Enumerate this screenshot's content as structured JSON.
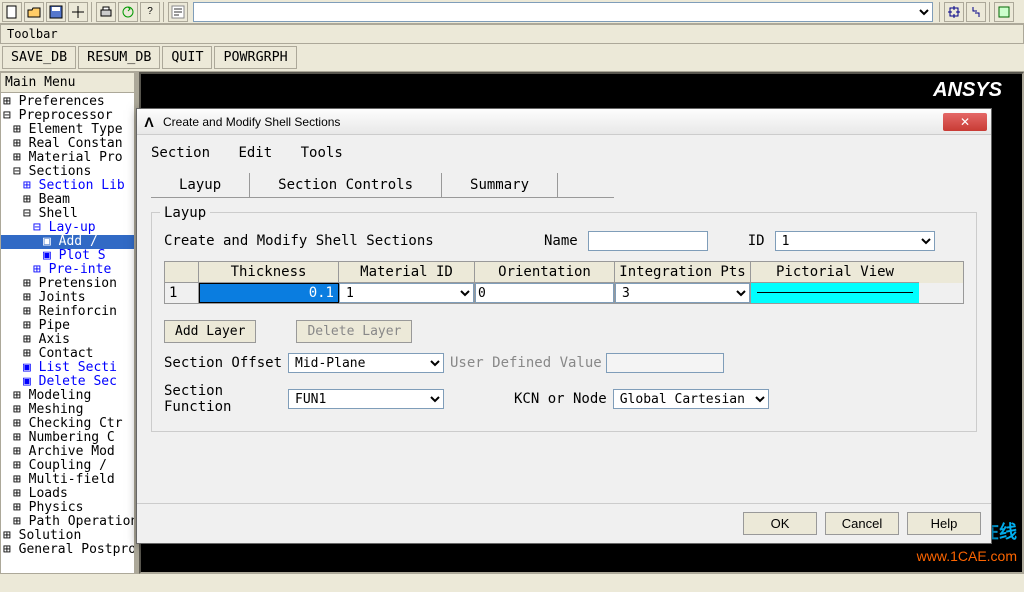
{
  "toolbar": {
    "label": "Toolbar",
    "buttons": [
      "SAVE_DB",
      "RESUM_DB",
      "QUIT",
      "POWRGRPH"
    ]
  },
  "tree": {
    "header": "Main Menu",
    "items": [
      {
        "t": "⊞ Preferences",
        "ind": 0,
        "cls": ""
      },
      {
        "t": "⊟ Preprocessor",
        "ind": 0,
        "cls": ""
      },
      {
        "t": "⊞ Element Type",
        "ind": 1,
        "cls": ""
      },
      {
        "t": "⊞ Real Constan",
        "ind": 1,
        "cls": ""
      },
      {
        "t": "⊞ Material Pro",
        "ind": 1,
        "cls": ""
      },
      {
        "t": "⊟ Sections",
        "ind": 1,
        "cls": ""
      },
      {
        "t": "⊞ Section Lib",
        "ind": 2,
        "cls": "blue"
      },
      {
        "t": "⊞ Beam",
        "ind": 2,
        "cls": ""
      },
      {
        "t": "⊟ Shell",
        "ind": 2,
        "cls": ""
      },
      {
        "t": "⊟ Lay-up",
        "ind": 3,
        "cls": "blue"
      },
      {
        "t": "▣ Add /",
        "ind": 4,
        "cls": "selected"
      },
      {
        "t": "▣ Plot S",
        "ind": 4,
        "cls": "blue"
      },
      {
        "t": "⊞ Pre-inte",
        "ind": 3,
        "cls": "blue"
      },
      {
        "t": "⊞ Pretension",
        "ind": 2,
        "cls": ""
      },
      {
        "t": "⊞ Joints",
        "ind": 2,
        "cls": ""
      },
      {
        "t": "⊞ Reinforcin",
        "ind": 2,
        "cls": ""
      },
      {
        "t": "⊞ Pipe",
        "ind": 2,
        "cls": ""
      },
      {
        "t": "⊞ Axis",
        "ind": 2,
        "cls": ""
      },
      {
        "t": "⊞ Contact",
        "ind": 2,
        "cls": ""
      },
      {
        "t": "▣ List Secti",
        "ind": 2,
        "cls": "blue"
      },
      {
        "t": "▣ Delete Sec",
        "ind": 2,
        "cls": "blue"
      },
      {
        "t": "⊞ Modeling",
        "ind": 1,
        "cls": ""
      },
      {
        "t": "⊞ Meshing",
        "ind": 1,
        "cls": ""
      },
      {
        "t": "⊞ Checking Ctr",
        "ind": 1,
        "cls": ""
      },
      {
        "t": "⊞ Numbering C",
        "ind": 1,
        "cls": ""
      },
      {
        "t": "⊞ Archive Mod",
        "ind": 1,
        "cls": ""
      },
      {
        "t": "⊞ Coupling / ",
        "ind": 1,
        "cls": ""
      },
      {
        "t": "⊞ Multi-field",
        "ind": 1,
        "cls": ""
      },
      {
        "t": "⊞ Loads",
        "ind": 1,
        "cls": ""
      },
      {
        "t": "⊞ Physics",
        "ind": 1,
        "cls": ""
      },
      {
        "t": "⊞ Path Operations",
        "ind": 1,
        "cls": ""
      },
      {
        "t": "⊞ Solution",
        "ind": 0,
        "cls": ""
      },
      {
        "t": "⊞ General Postproc",
        "ind": 0,
        "cls": ""
      }
    ]
  },
  "graphics": {
    "logo": "ANSYS",
    "wm1": "仿真在线",
    "wm2": "www.1CAE.com"
  },
  "dialog": {
    "title": "Create and Modify Shell Sections",
    "menu": [
      "Section",
      "Edit",
      "Tools"
    ],
    "tabs": [
      "Layup",
      "Section Controls",
      "Summary"
    ],
    "fieldset_legend": "Layup",
    "subtitle": "Create and Modify Shell Sections",
    "name_label": "Name",
    "name_value": "",
    "id_label": "ID",
    "id_value": "1",
    "headers": {
      "thk": "Thickness",
      "mat": "Material ID",
      "ori": "Orientation",
      "int": "Integration Pts",
      "pic": "Pictorial View"
    },
    "row": {
      "idx": "1",
      "thk": "0.1",
      "mat": "1",
      "ori": "0",
      "int": "3"
    },
    "add_layer": "Add Layer",
    "delete_layer": "Delete Layer",
    "offset_label": "Section Offset",
    "offset_value": "Mid-Plane",
    "udv_label": "User Defined Value",
    "udv_value": "",
    "func_label": "Section Function",
    "func_value": "FUN1",
    "kcn_label": "KCN or Node",
    "kcn_value": "Global Cartesian",
    "footer": {
      "ok": "OK",
      "cancel": "Cancel",
      "help": "Help"
    }
  }
}
